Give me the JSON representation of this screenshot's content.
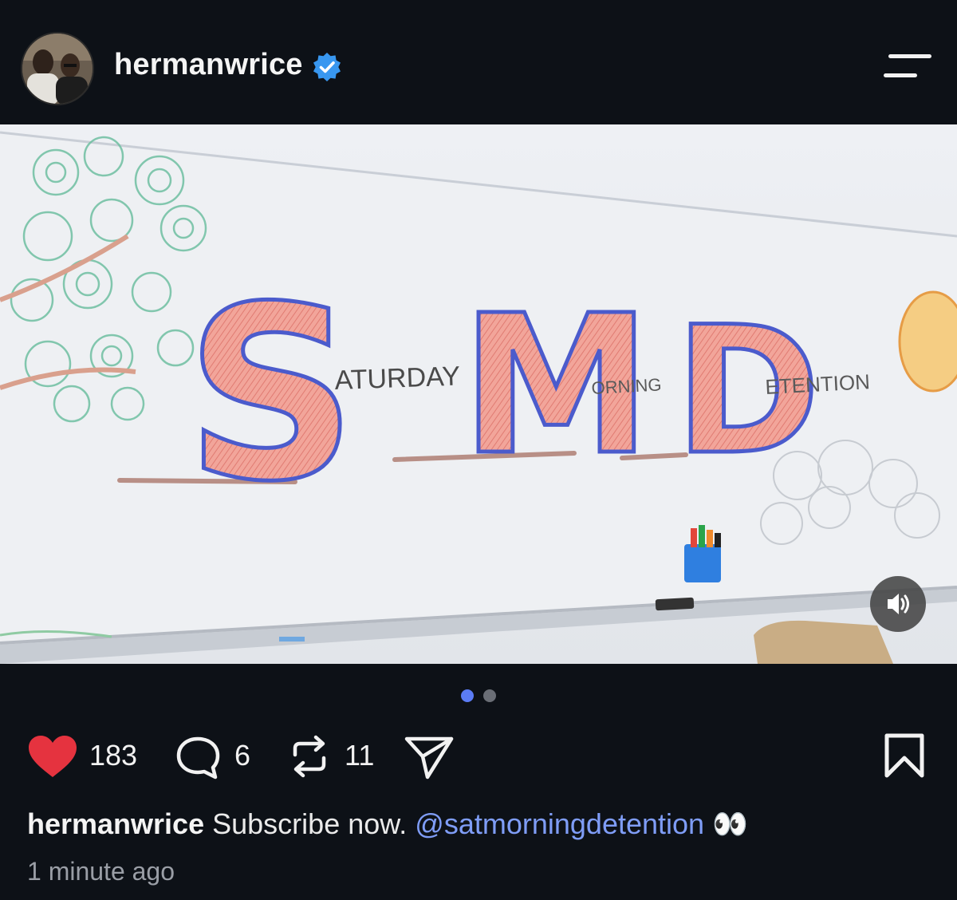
{
  "post": {
    "username": "hermanwrice",
    "verified": true,
    "avatar_alt": "profile photo"
  },
  "media": {
    "board_big_letters": [
      "S",
      "M",
      "D"
    ],
    "board_small_words": [
      "ATURDAY",
      "ORNING",
      "ETENTION"
    ],
    "carousel_count": 2,
    "carousel_active": 0,
    "sound_icon": "speaker-icon"
  },
  "actions": {
    "likes": "183",
    "comments": "6",
    "reposts": "11",
    "like_color": "#e5333f"
  },
  "caption": {
    "user": "hermanwrice",
    "text": "Subscribe now.",
    "mention": "@satmorningdetention",
    "emoji": "👀"
  },
  "timestamp": "1 minute ago",
  "colors": {
    "background": "#0d1117",
    "mention": "#7f9df7",
    "verified_badge": "#3897f0",
    "active_dot": "#5b7cf5"
  }
}
